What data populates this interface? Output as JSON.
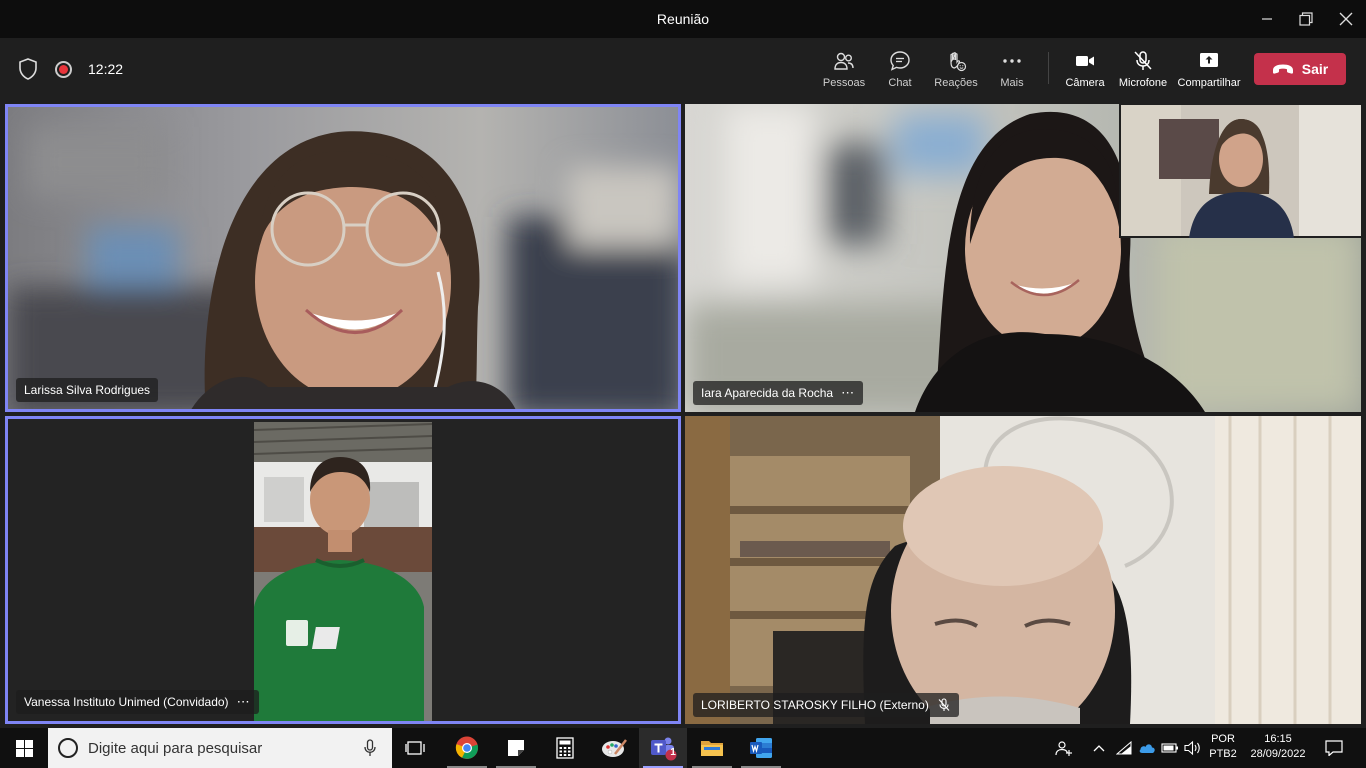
{
  "window": {
    "title": "Reunião"
  },
  "meeting": {
    "elapsed": "12:22"
  },
  "toolbar": {
    "people": "Pessoas",
    "chat": "Chat",
    "reactions": "Reações",
    "more": "Mais",
    "camera": "Câmera",
    "microphone": "Microfone",
    "share": "Compartilhar",
    "leave": "Sair"
  },
  "participants": [
    {
      "name": "Larissa Silva Rodrigues",
      "highlighted": true
    },
    {
      "name": "Iara Aparecida da Rocha",
      "more": "⋯"
    },
    {
      "name": "Vanessa Instituto Unimed (Convidado)",
      "more": "⋯",
      "highlighted": true
    },
    {
      "name": "LORIBERTO STAROSKY FILHO (Externo)",
      "muted": true
    }
  ],
  "taskbar": {
    "search_placeholder": "Digite aqui para pesquisar",
    "teams_badge": "1",
    "apps": [
      "task-view",
      "chrome",
      "sticky-notes",
      "calculator",
      "paint",
      "teams",
      "file-explorer",
      "word"
    ]
  },
  "tray": {
    "lang_top": "POR",
    "lang_bottom": "PTB2",
    "time": "16:15",
    "date": "28/09/2022"
  },
  "colors": {
    "highlight_border": "#7f85f5",
    "leave_button": "#c4314b",
    "record_dot": "#e8343b"
  }
}
